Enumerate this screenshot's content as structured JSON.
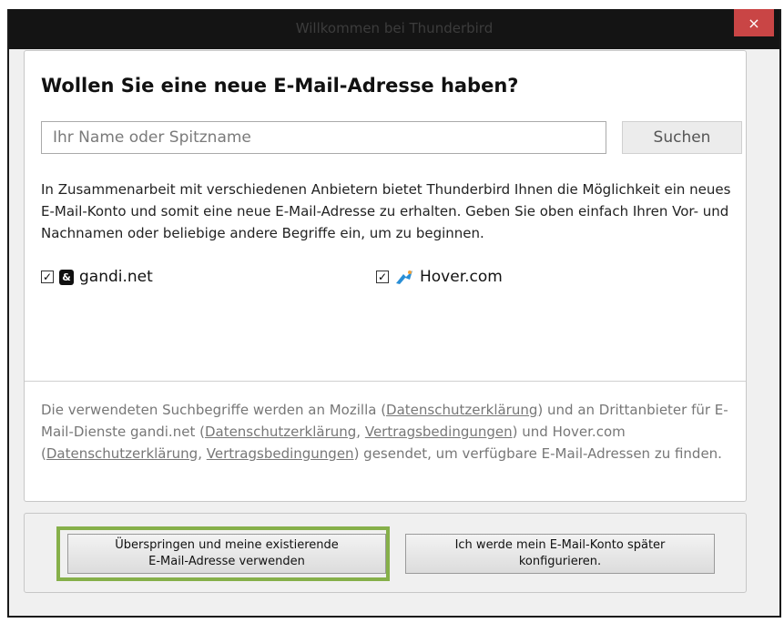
{
  "window": {
    "title": "Willkommen bei Thunderbird",
    "close_label": "×"
  },
  "search": {
    "heading": "Wollen Sie eine neue E-Mail-Adresse haben?",
    "placeholder": "Ihr Name oder Spitzname",
    "button_label": "Suchen"
  },
  "description": "In Zusammenarbeit mit verschiedenen Anbietern bietet Thunderbird Ihnen die Möglichkeit ein neues E-Mail-Konto und somit eine neue E-Mail-Adresse zu erhalten. Geben Sie oben einfach Ihren Vor- und Nachnamen oder beliebige andere Begriffe ein, um zu beginnen.",
  "providers": [
    {
      "name": "gandi.net",
      "checked": true,
      "icon": "gandi-logo-icon"
    },
    {
      "name": "Hover.com",
      "checked": true,
      "icon": "hover-logo-icon"
    }
  ],
  "privacy": {
    "t1": "Die verwendeten Suchbegriffe werden an Mozilla (",
    "l1": "Datenschutzerklärung",
    "t2": ") und an Drittanbieter für E-Mail-Dienste gandi.net (",
    "l2": "Datenschutzerklärung",
    "t3": ", ",
    "l3": "Vertragsbedingungen",
    "t4": ") und Hover.com (",
    "l4": "Datenschutzerklärung",
    "t5": ", ",
    "l5": "Vertragsbedingungen",
    "t6": ") gesendet, um verfügbare E-Mail-Adressen zu finden."
  },
  "buttons": {
    "skip_line1": "Überspringen und meine existierende",
    "skip_line2": "E-Mail-Adresse verwenden",
    "later_line1": "Ich werde mein E-Mail-Konto später",
    "later_line2": "konfigurieren."
  },
  "colors": {
    "highlight": "#86b04a",
    "close_button": "#c94545",
    "titlebar": "#141414"
  }
}
